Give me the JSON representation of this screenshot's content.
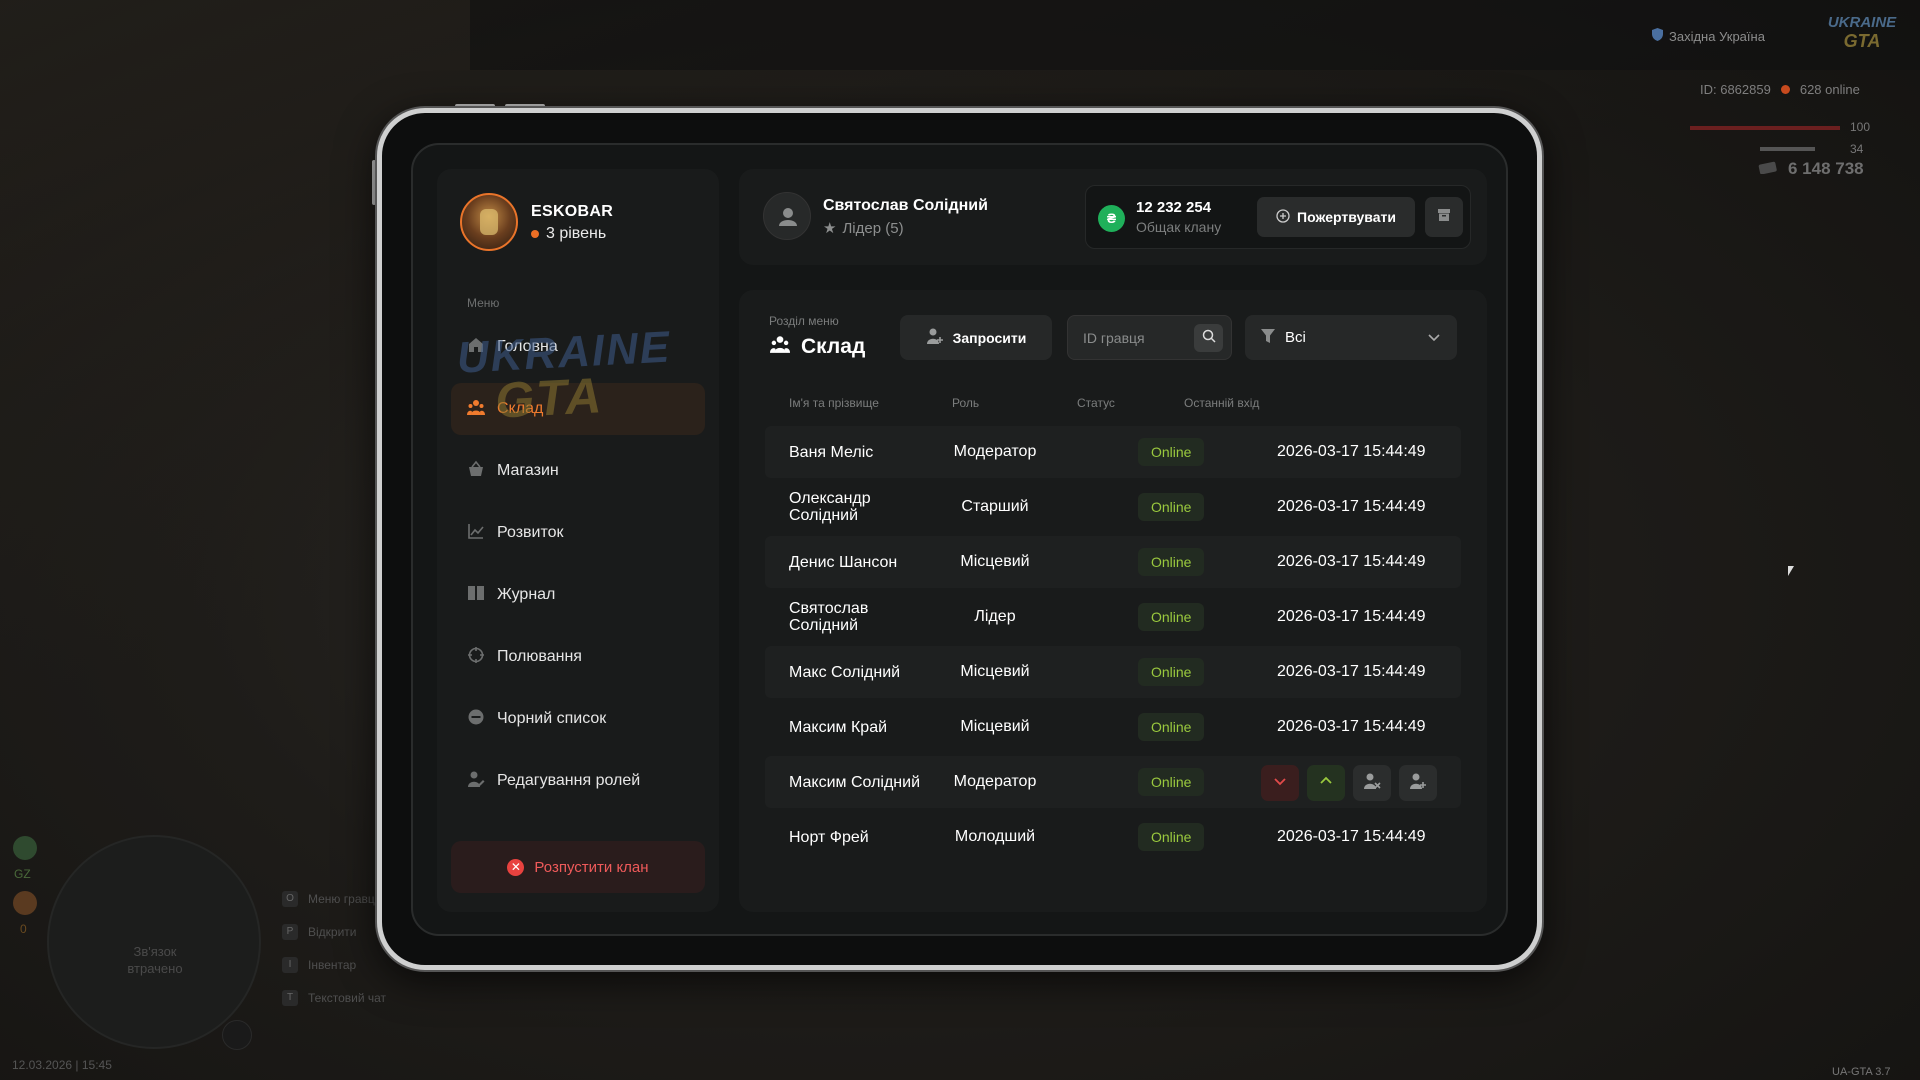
{
  "hud": {
    "region": "Західна Україна",
    "logo_line1": "UKRAINE",
    "logo_line2": "GTA",
    "player_id": "ID: 6862859",
    "online": "628 online",
    "health": "100",
    "armor": "34",
    "money": "6 148 738",
    "minimap_text": "Зв'язок втрачено",
    "keyhints": [
      {
        "key": "O",
        "label": "Меню гравця"
      },
      {
        "key": "P",
        "label": "Відкрити"
      },
      {
        "key": "I",
        "label": "Інвентар"
      },
      {
        "key": "T",
        "label": "Текстовий чат"
      }
    ],
    "gz": "GZ",
    "zero": "0",
    "datetime": "12.03.2026 | 15:45",
    "version": "UA-GTA 3.7"
  },
  "profile": {
    "name": "ESKOBAR",
    "level": "3 рівень"
  },
  "sidebar": {
    "menu_caption": "Меню",
    "items": [
      {
        "label": "Головна",
        "icon": "home-icon"
      },
      {
        "label": "Склад",
        "icon": "members-icon"
      },
      {
        "label": "Магазин",
        "icon": "shop-icon"
      },
      {
        "label": "Розвиток",
        "icon": "chart-icon"
      },
      {
        "label": "Журнал",
        "icon": "book-icon"
      },
      {
        "label": "Полювання",
        "icon": "crosshair-icon"
      },
      {
        "label": "Чорний список",
        "icon": "ban-icon"
      },
      {
        "label": "Редагування ролей",
        "icon": "user-edit-icon"
      }
    ],
    "active_index": 1,
    "disband_label": "Розпустити клан"
  },
  "topcard": {
    "user_name": "Святослав Солідний",
    "user_role": "Лідер (5)",
    "bank_amount": "12 232 254",
    "bank_label": "Общак клану",
    "coin_symbol": "₴",
    "donate_label": "Пожертвувати"
  },
  "section": {
    "caption": "Розділ меню",
    "title": "Склад",
    "invite_label": "Запросити",
    "search_placeholder": "ID гравця",
    "filter_value": "Всі"
  },
  "table": {
    "headers": [
      "Ім'я та прізвище",
      "Роль",
      "Статус",
      "Останній вхід"
    ],
    "rows": [
      {
        "name": "Ваня Меліс",
        "role": "Модератор",
        "status": "Online",
        "last": "2026-03-17 15:44:49"
      },
      {
        "name": "Олександр Солідний",
        "role": "Старший",
        "status": "Online",
        "last": "2026-03-17 15:44:49"
      },
      {
        "name": "Денис Шансон",
        "role": "Місцевий",
        "status": "Online",
        "last": "2026-03-17 15:44:49"
      },
      {
        "name": "Святослав Солідний",
        "role": "Лідер",
        "status": "Online",
        "last": "2026-03-17 15:44:49"
      },
      {
        "name": "Макс Солідний",
        "role": "Місцевий",
        "status": "Online",
        "last": "2026-03-17 15:44:49"
      },
      {
        "name": "Максим Край",
        "role": "Місцевий",
        "status": "Online",
        "last": "2026-03-17 15:44:49"
      },
      {
        "name": "Максим Солідний",
        "role": "Модератор",
        "status": "Online",
        "last": ""
      },
      {
        "name": "Норт Фрей",
        "role": "Молодший",
        "status": "Online",
        "last": "2026-03-17 15:44:49"
      }
    ]
  },
  "colors": {
    "accent": "#f07b2e",
    "online": "#9ac93e",
    "danger": "#ef5a5a",
    "coin": "#1fb05a"
  }
}
